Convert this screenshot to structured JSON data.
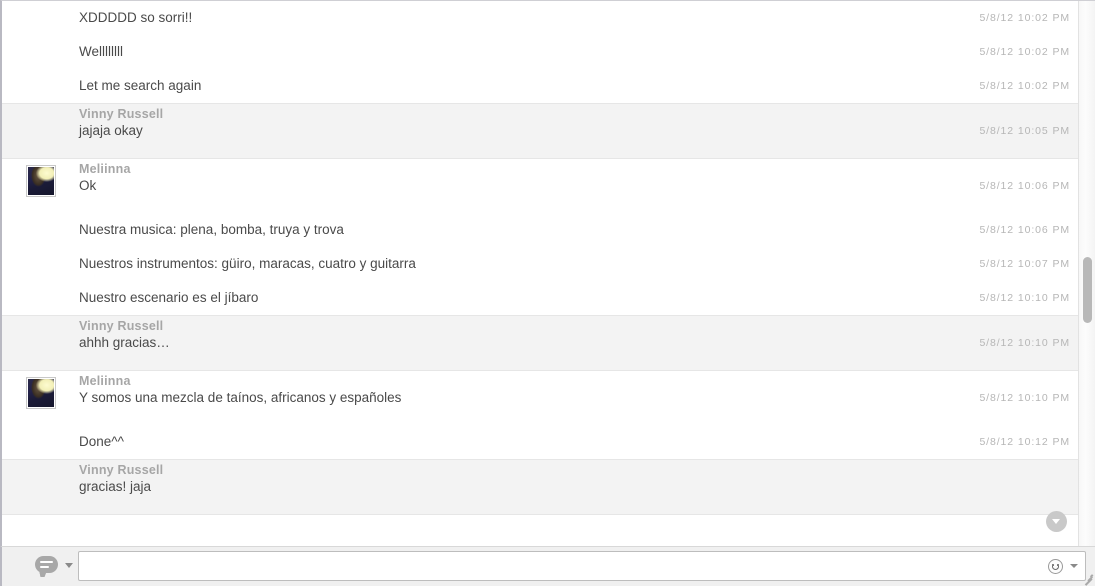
{
  "window": {
    "type": "instant-messenger-conversation"
  },
  "conversation": {
    "groups": [
      {
        "sender": null,
        "avatar": false,
        "alt": false,
        "messages": [
          {
            "text": "XDDDDD so sorri!!",
            "time": "5/8/12 10:02 PM"
          },
          {
            "text": "Wellllllll",
            "time": "5/8/12 10:02 PM"
          },
          {
            "text": "Let me search again",
            "time": "5/8/12 10:02 PM"
          }
        ]
      },
      {
        "sender": "Vinny Russell",
        "avatar": false,
        "alt": true,
        "messages": [
          {
            "text": "jajaja okay",
            "time": "5/8/12 10:05 PM"
          }
        ]
      },
      {
        "sender": "Meliinna",
        "avatar": true,
        "alt": false,
        "messages": [
          {
            "text": "Ok",
            "time": "5/8/12 10:06 PM"
          },
          {
            "text": "Nuestra musica: plena, bomba, truya y trova",
            "time": "5/8/12 10:06 PM"
          },
          {
            "text": "Nuestros instrumentos: güiro, maracas, cuatro y guitarra",
            "time": "5/8/12 10:07 PM"
          },
          {
            "text": "Nuestro escenario es el jíbaro",
            "time": "5/8/12 10:10 PM"
          }
        ]
      },
      {
        "sender": "Vinny Russell",
        "avatar": false,
        "alt": true,
        "messages": [
          {
            "text": "ahhh gracias…",
            "time": "5/8/12 10:10 PM"
          }
        ]
      },
      {
        "sender": "Meliinna",
        "avatar": true,
        "alt": false,
        "messages": [
          {
            "text": "Y somos una mezcla de taínos, africanos y españoles",
            "time": "5/8/12 10:10 PM"
          },
          {
            "text": "Done^^",
            "time": "5/8/12 10:12 PM"
          }
        ]
      },
      {
        "sender": "Vinny Russell",
        "avatar": false,
        "alt": true,
        "messages": [
          {
            "text": "gracias! jaja",
            "time": ""
          }
        ]
      }
    ]
  },
  "composer": {
    "input_value": "",
    "input_placeholder": "",
    "emote_icon": "speech-bubble-icon",
    "emote_caret_icon": "chevron-down-icon",
    "smiley_icon": "smiley-face-icon",
    "smiley_caret_icon": "chevron-down-icon"
  },
  "controls": {
    "jump_to_bottom_icon": "chevron-down-circle-icon",
    "resize_grip_icon": "resize-handle-icon",
    "scrollbar_icon": "vertical-scrollbar"
  },
  "colors": {
    "row_default": "#ffffff",
    "row_alt": "#f3f3f3",
    "sender_text": "#a6a6a6",
    "message_text": "#4a4a4a",
    "timestamp_text": "#b6b6b6",
    "scrollbar_thumb": "#b8b8b8"
  }
}
